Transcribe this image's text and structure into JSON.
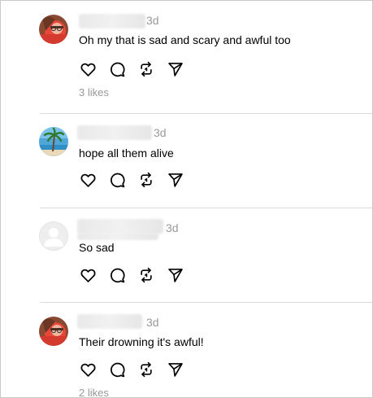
{
  "comments": [
    {
      "time": "3d",
      "text": "Oh my that is sad and scary and awful too",
      "likes": "3 likes",
      "avatar": "selfie-glasses-red"
    },
    {
      "time": "3d",
      "text": "hope all them alive",
      "likes": "",
      "avatar": "palm-tree-beach"
    },
    {
      "time": "3d",
      "text": "So sad",
      "likes": "",
      "avatar": "default-person"
    },
    {
      "time": "3d",
      "text": "Their drowning it's awful!",
      "likes": "2 likes",
      "avatar": "selfie-glasses-red"
    }
  ],
  "icons": {
    "like": "heart-icon",
    "reply": "comment-bubble-icon",
    "repost": "repost-arrows-icon",
    "share": "send-paper-plane-icon"
  },
  "colors": {
    "text": "#000000",
    "muted": "#999999",
    "divider": "#dbdbdb"
  }
}
